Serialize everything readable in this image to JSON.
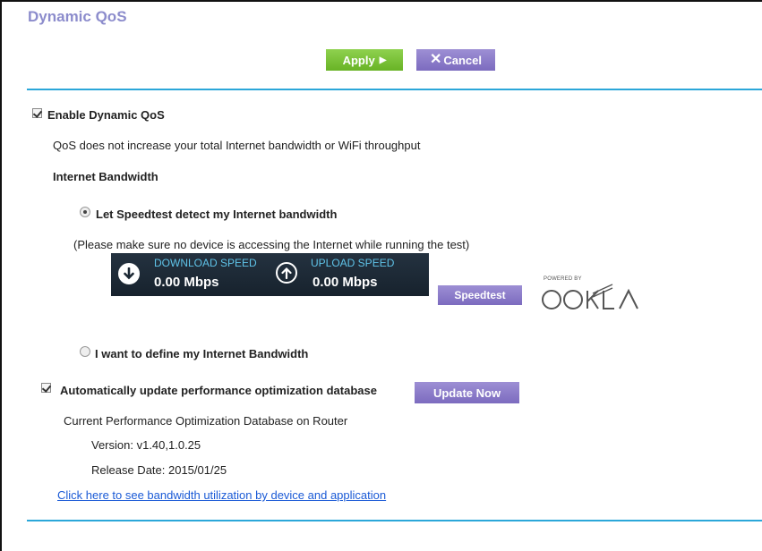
{
  "page": {
    "title": "Dynamic QoS"
  },
  "toolbar": {
    "apply_label": "Apply",
    "cancel_label": "Cancel"
  },
  "qos": {
    "enable_label": "Enable Dynamic QoS",
    "enable_checked": true,
    "note": "QoS does not increase your total Internet bandwidth or WiFi throughput",
    "bandwidth_heading": "Internet Bandwidth",
    "option_speedtest_label": "Let Speedtest detect my Internet bandwidth",
    "option_speedtest_selected": true,
    "speedtest_note": "(Please make sure no device is accessing the Internet while running the test)",
    "download_label": "DOWNLOAD SPEED",
    "download_value": "0.00 Mbps",
    "upload_label": "UPLOAD SPEED",
    "upload_value": "0.00 Mbps",
    "speedtest_button": "Speedtest",
    "powered_by": "POWERED BY",
    "option_manual_label": "I want to define my Internet Bandwidth",
    "option_manual_selected": false
  },
  "database": {
    "auto_update_label": "Automatically update performance optimization database",
    "auto_update_checked": true,
    "update_button": "Update Now",
    "current_label": "Current Performance Optimization Database on Router",
    "version": "Version: v1.40,1.0.25",
    "release_date": "Release Date: 2015/01/25"
  },
  "link": {
    "text": "Click here to see bandwidth utilization by device and application"
  },
  "colors": {
    "accent_line": "#2ba7d9",
    "title": "#8c8ccc",
    "apply_green": "#7cc23a",
    "button_purple": "#8a7bc8",
    "link": "#1a5ad6"
  },
  "icons": {
    "download": "arrow-down-circle-icon",
    "upload": "arrow-up-circle-icon",
    "checkbox": "checkbox-checked-icon",
    "radio": "radio-icon",
    "logo": "ookla-logo"
  }
}
